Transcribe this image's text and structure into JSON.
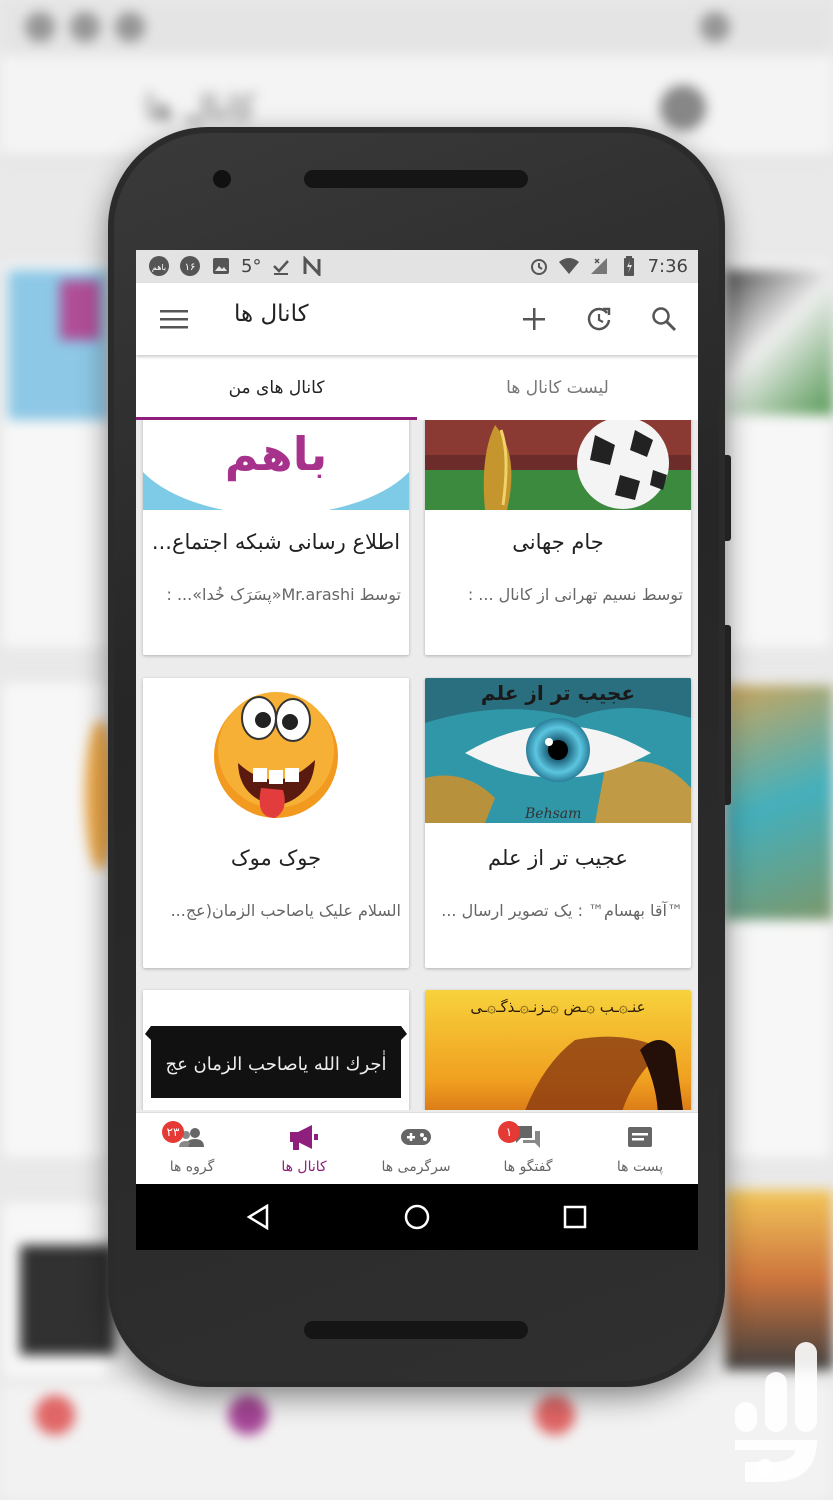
{
  "status_bar": {
    "time": "7:36",
    "left_icons": [
      "bahm-notification-icon",
      "number-16-notification-icon",
      "image-notification-icon",
      "temperature-notification-icon",
      "download-done-icon",
      "n-app-icon"
    ],
    "temperature": "5°",
    "notif_count": "۱۶",
    "bahm_label": "باهم",
    "right_icons": [
      "alarm-icon",
      "wifi-icon",
      "signal-icon",
      "battery-icon"
    ]
  },
  "app_bar": {
    "title": "کانال ها",
    "menu_icon": "hamburger-menu-icon",
    "actions": [
      "search-icon",
      "refresh-icon",
      "add-icon"
    ]
  },
  "tabs": {
    "active": "کانال های من",
    "inactive": "لیست کانال ها"
  },
  "cards": [
    {
      "title": "اطلاع رسانی شبکه اجتماع...",
      "subtitle": "توسط Mr.arashi«پِسَرَک خُدا»...  :",
      "image_text": "باهم"
    },
    {
      "title": "جام جهانی",
      "subtitle": "توسط نسیم تهرانی از کانال ...  :"
    },
    {
      "title": "جوک موک",
      "subtitle": "السلام علیک یاصاحب الزمان(عج..."
    },
    {
      "title": "عجیب تر از علم",
      "subtitle": "™آقا بهسام™ : یک تصویر ارسال ...",
      "image_text": "عجیب تر از علم",
      "image_signature": "Behsam"
    },
    {
      "title": "",
      "subtitle": "",
      "image_text": "اٰجرك الله یاصاحب الزمان عج"
    },
    {
      "title": "",
      "subtitle": "",
      "image_text": "عنـ۞ـب ۞ـض ۞ـزنـ۞ـذگـ۞ـی"
    }
  ],
  "bottom_nav": [
    {
      "label": "گروه ها",
      "icon": "groups-icon",
      "badge": "۲۳"
    },
    {
      "label": "کانال ها",
      "icon": "megaphone-icon",
      "active": true
    },
    {
      "label": "سرگرمی ها",
      "icon": "gamepad-icon"
    },
    {
      "label": "گفتگو ها",
      "icon": "chat-icon",
      "badge": "۱"
    },
    {
      "label": "پست ها",
      "icon": "post-icon"
    }
  ],
  "colors": {
    "accent": "#8e1f7c",
    "badge": "#e53935"
  }
}
